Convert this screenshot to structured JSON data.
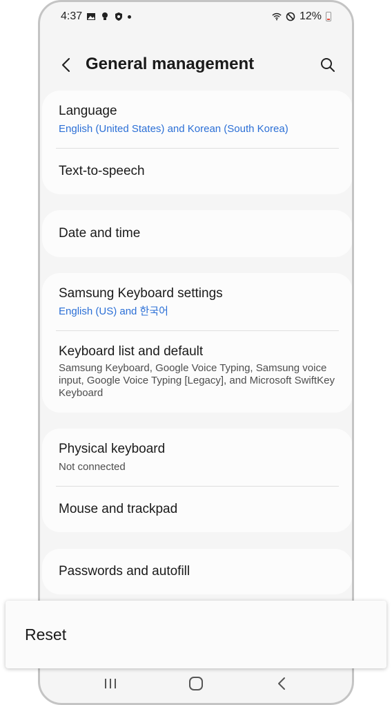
{
  "status_bar": {
    "time": "4:37",
    "battery_text": "12%",
    "left_icons": [
      "gallery-icon",
      "bulb-icon",
      "shield-icon",
      "dot-icon"
    ],
    "right_icons": [
      "wifi-icon",
      "do-not-disturb-icon",
      "battery-icon"
    ]
  },
  "header": {
    "title": "General management"
  },
  "groups": [
    {
      "items": [
        {
          "title": "Language",
          "subtitle": "English (United States) and Korean (South Korea)",
          "subtitle_color": "#2b6fd6"
        },
        {
          "title": "Text-to-speech"
        }
      ]
    },
    {
      "items": [
        {
          "title": "Date and time"
        }
      ]
    },
    {
      "items": [
        {
          "title": "Samsung Keyboard settings",
          "subtitle": "English (US) and 한국어",
          "subtitle_color": "#2b6fd6"
        },
        {
          "title": "Keyboard list and default",
          "subtitle": "Samsung Keyboard, Google Voice Typing, Samsung voice input, Google Voice Typing [Legacy], and Microsoft SwiftKey Keyboard"
        }
      ]
    },
    {
      "items": [
        {
          "title": "Physical keyboard",
          "subtitle": "Not connected"
        },
        {
          "title": "Mouse and trackpad"
        }
      ]
    },
    {
      "items": [
        {
          "title": "Passwords and autofill"
        }
      ]
    }
  ],
  "reset": {
    "label": "Reset"
  },
  "nav_bar": {
    "icons": [
      "recents-icon",
      "home-icon",
      "back-icon"
    ]
  },
  "colors": {
    "accent_blue": "#2b6fd6",
    "background": "#f5f5f5",
    "card": "#fcfcfc"
  }
}
